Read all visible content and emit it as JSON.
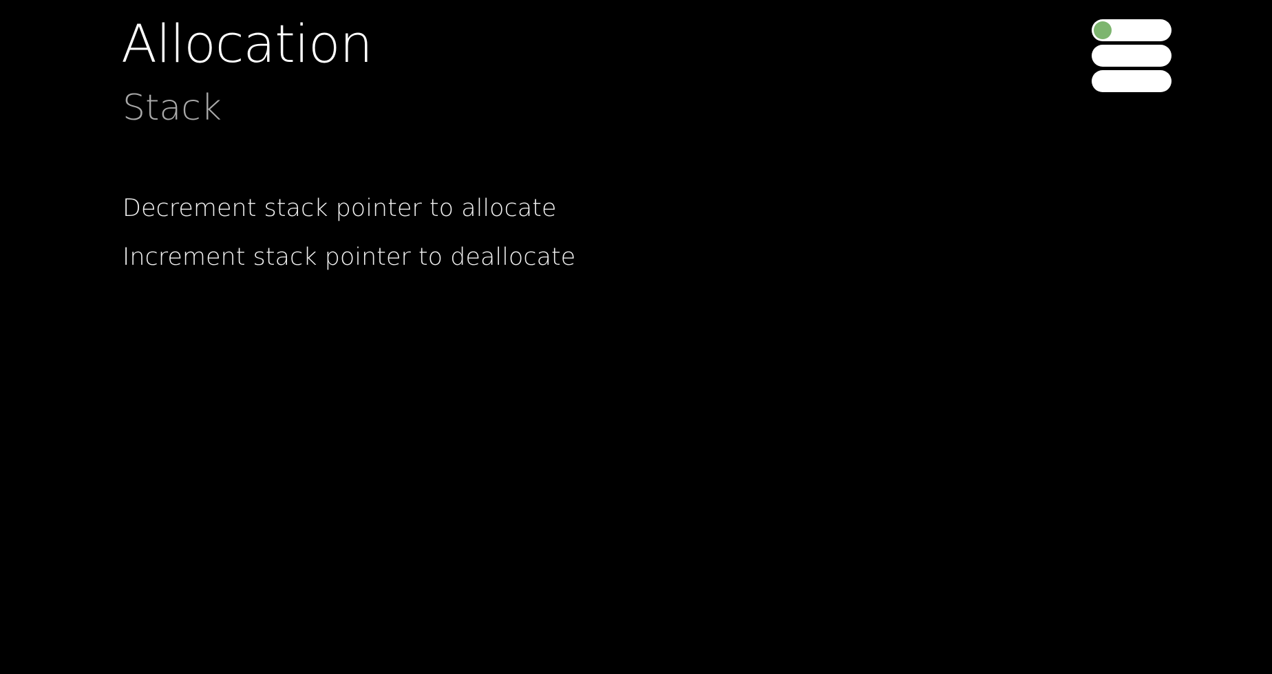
{
  "slide": {
    "title": "Allocation",
    "subtitle": "Stack",
    "bullets": [
      "Decrement stack pointer to allocate",
      "Increment stack pointer to deallocate"
    ]
  },
  "icon": {
    "name": "stack-layers-icon",
    "bar_color": "#ffffff",
    "indicator_color": "#7db56f"
  },
  "colors": {
    "background": "#000000",
    "title": "#ffffff",
    "subtitle": "#a9a9a9",
    "body": "#f2f2f2"
  }
}
